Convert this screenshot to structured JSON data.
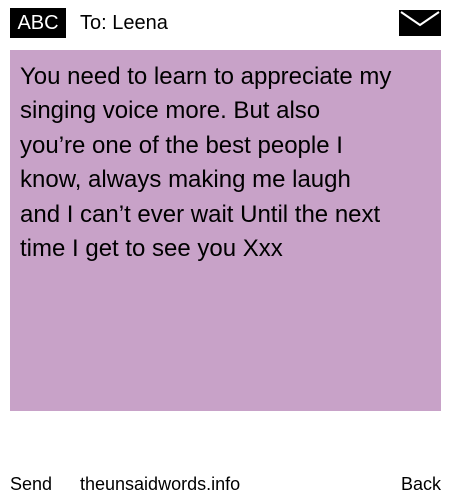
{
  "header": {
    "input_mode": "ABC",
    "recipient": "To: Leena",
    "envelope_icon": "envelope-icon"
  },
  "message": {
    "background_color": "#c8a2c8",
    "text": "You need to learn to appreciate my\nsinging voice more. But also\nyou’re one of the best people I\nknow, always making me laugh\nand I can’t ever wait Until the next\ntime I get to see you Xxx"
  },
  "footer": {
    "send_label": "Send",
    "site_label": "theunsaidwords.info",
    "back_label": "Back"
  }
}
